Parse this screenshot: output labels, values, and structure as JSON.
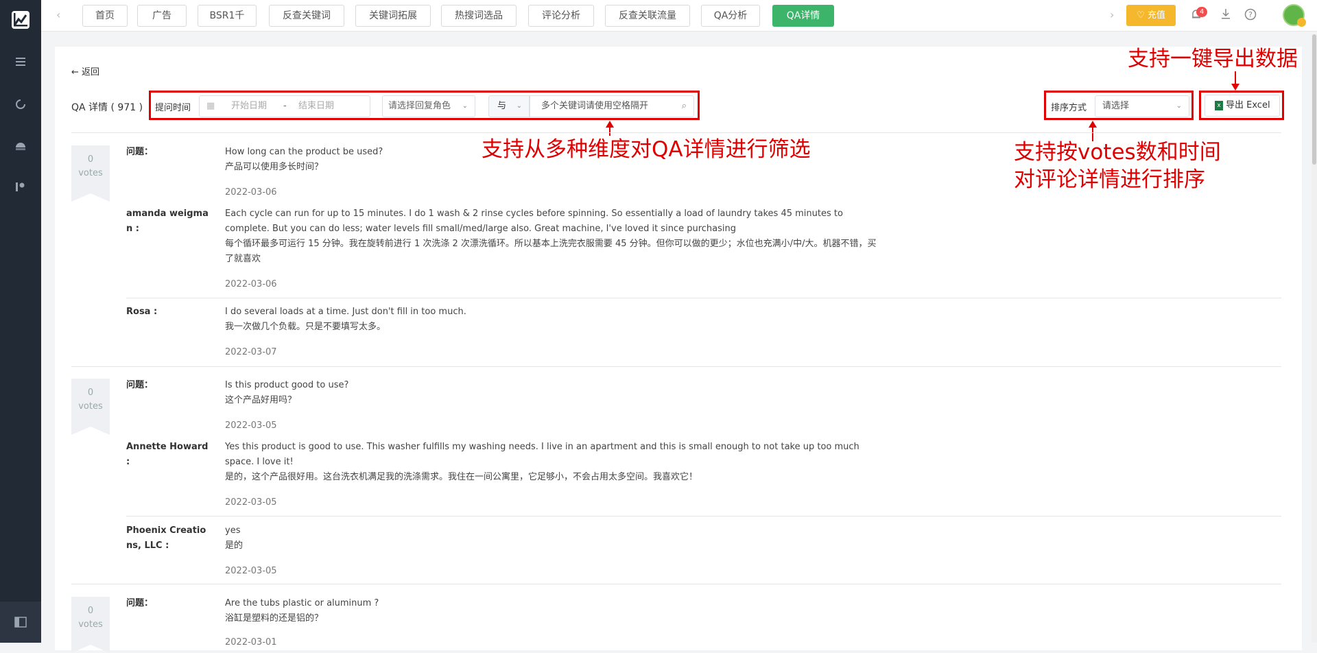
{
  "nav": {
    "tabs": [
      "首页",
      "广告",
      "BSR1千",
      "反查关键词",
      "关键词拓展",
      "热搜词选品",
      "评论分析",
      "反查关联流量",
      "QA分析",
      "QA详情"
    ],
    "active_tab": "QA详情",
    "recharge_label": "充值",
    "notification_count": "4"
  },
  "page": {
    "back_label": "返回",
    "title": "QA 详情 ( 971 )"
  },
  "filters": {
    "time_label": "提问时间",
    "start_placeholder": "开始日期",
    "date_separator": "-",
    "end_placeholder": "结束日期",
    "role_placeholder": "请选择回复角色",
    "logic_value": "与",
    "keyword_placeholder": "多个关键词请使用空格隔开"
  },
  "sort": {
    "label": "排序方式",
    "placeholder": "请选择"
  },
  "export": {
    "label": "导出 Excel"
  },
  "annotations": {
    "export": "支持一键导出数据",
    "filter": "支持从多种维度对QA详情进行筛选",
    "sort_line1": "支持按votes数和时间",
    "sort_line2": "对评论详情进行排序"
  },
  "qa_items": [
    {
      "votes": "0",
      "votes_label": "votes",
      "question_label": "问题：",
      "question_en": "How long can the product be used?",
      "question_cn": "产品可以使用多长时间？",
      "question_date": "2022-03-06",
      "answers": [
        {
          "author": "amanda weigman :",
          "text_en": "Each cycle can run for up to 15 minutes. I do 1 wash & 2 rinse cycles before spinning. So essentially a load of laundry takes 45 minutes to complete. But you can do less; water levels fill small/med/large also. Great machine, I've loved it since purchasing",
          "text_cn": "每个循环最多可运行 15 分钟。我在旋转前进行 1 次洗涤 2 次漂洗循环。所以基本上洗完衣服需要 45 分钟。但你可以做的更少；水位也充满小/中/大。机器不错，买了就喜欢",
          "date": "2022-03-06"
        },
        {
          "author": "Rosa :",
          "text_en": "I do several loads at a time. Just don't fill in too much.",
          "text_cn": "我一次做几个负载。只是不要填写太多。",
          "date": "2022-03-07"
        }
      ]
    },
    {
      "votes": "0",
      "votes_label": "votes",
      "question_label": "问题：",
      "question_en": "Is this product good to use?",
      "question_cn": "这个产品好用吗？",
      "question_date": "2022-03-05",
      "answers": [
        {
          "author": "Annette Howard :",
          "text_en": "Yes this product is good to use. This washer fulfills my washing needs. I live in an apartment and this is small enough to not take up too much space. I love it!",
          "text_cn": "是的，这个产品很好用。这台洗衣机满足我的洗涤需求。我住在一间公寓里，它足够小，不会占用太多空间。我喜欢它！",
          "date": "2022-03-05"
        },
        {
          "author": "Phoenix Creations, LLC :",
          "text_en": "yes",
          "text_cn": "是的",
          "date": "2022-03-05"
        }
      ]
    },
    {
      "votes": "0",
      "votes_label": "votes",
      "question_label": "问题：",
      "question_en": "Are the tubs plastic or aluminum ?",
      "question_cn": "浴缸是塑料的还是铝的？",
      "question_date": "2022-03-01"
    }
  ],
  "colors": {
    "sidebar": "#222a36",
    "active_tab": "#3cb56a",
    "recharge": "#f5b72b",
    "annotation": "#e00000",
    "excel_icon": "#1d7a44"
  }
}
